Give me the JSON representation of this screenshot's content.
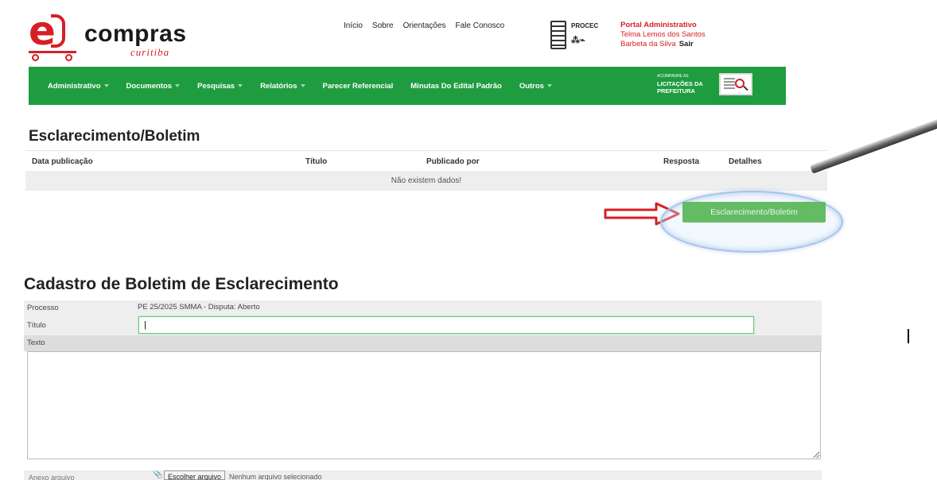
{
  "logo": {
    "letter": "e",
    "word": "compras",
    "sub": "curitiba"
  },
  "topnav": [
    "Início",
    "Sobre",
    "Orientações",
    "Fale Conosco"
  ],
  "procec": {
    "name": "PROCEC"
  },
  "portal": {
    "title": "Portal Administrativo",
    "user_line1": "Telma Lemos dos Santos",
    "user_line2": "Barbeta da Silva",
    "logout": "Sair"
  },
  "menu": {
    "items": [
      "Administrativo",
      "Documentos",
      "Pesquisas",
      "Relatórios",
      "Parecer Referencial",
      "Minutas Do Edital Padrão",
      "Outros"
    ],
    "chevrons": [
      true,
      true,
      true,
      true,
      false,
      false,
      true
    ],
    "lic_small": "ACOMPANHE AS",
    "lic_big": "LICITAÇÕES DA PREFEITURA",
    "accent": "#1f9c3f"
  },
  "section1": {
    "title": "Esclarecimento/Boletim",
    "columns": [
      "Data publicação",
      "Título",
      "Publicado por",
      "Resposta",
      "Detalhes"
    ],
    "empty_message": "Não existem dados!",
    "button": "Esclarecimento/Boletim",
    "button_color": "#5cb85c"
  },
  "section2": {
    "title": "Cadastro de Boletim de Esclarecimento",
    "processo_label": "Processo",
    "processo_value": "PE 25/2025 SMMA - Disputa: Aberto",
    "titulo_label": "Título",
    "titulo_value": "|",
    "texto_label": "Texto",
    "anexo_label": "Anexo arquivo",
    "file_button": "Escolher arquivo",
    "file_none": "Nenhum arquivo selecionado"
  }
}
